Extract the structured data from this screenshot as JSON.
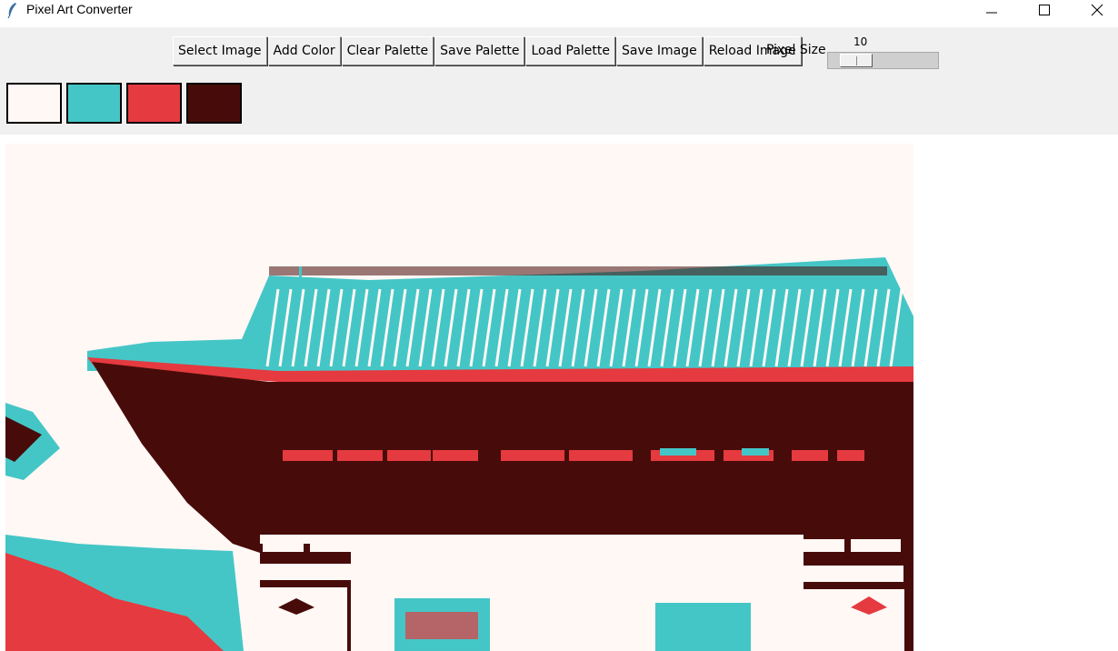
{
  "window": {
    "title": "Pixel Art Converter",
    "minimize_icon": "minimize-icon",
    "maximize_icon": "maximize-icon",
    "close_icon": "close-icon"
  },
  "toolbar": {
    "buttons": [
      {
        "label": "Select Image"
      },
      {
        "label": "Add Color"
      },
      {
        "label": "Clear Palette"
      },
      {
        "label": "Save Palette"
      },
      {
        "label": "Load Palette"
      },
      {
        "label": "Save Image"
      },
      {
        "label": "Reload Image"
      }
    ],
    "pixel_size_label": "Pixel Size",
    "pixel_size_value": "10",
    "pixel_size_fraction": 0.15
  },
  "palette": {
    "colors": [
      "#fff8f5",
      "#45c6c6",
      "#e53a3f",
      "#470c0a"
    ]
  },
  "canvas": {
    "image_description_colors": {
      "background": "#fff8f5",
      "roof": "#45c6c6",
      "accent": "#e53a3f",
      "structure": "#470c0a"
    }
  }
}
